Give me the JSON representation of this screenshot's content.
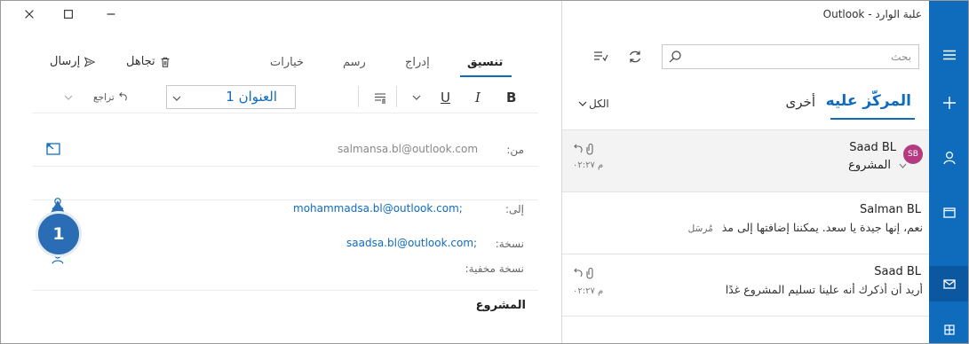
{
  "window": {
    "title": "علبة الوارد - Outlook"
  },
  "nav_rail": {
    "items": [
      "menu-icon",
      "new-icon",
      "people-icon",
      "calendar-icon",
      "mail-icon",
      "grid-icon"
    ],
    "active": "mail-icon"
  },
  "list": {
    "search_placeholder": "بحث",
    "tabs": {
      "focused": "المركّز عليه",
      "other": "أخرى"
    },
    "filter": "الكل",
    "messages": [
      {
        "sender": "Saad BL",
        "avatar": "SB",
        "subject": "المشروع",
        "time": "م ٠٢:٢٧",
        "selected": true
      },
      {
        "sender": "Salman BL",
        "preview": "نعم، إنها جيدة يا سعد. يمكننا إضافتها إلى مذ",
        "status": "مُرسَل"
      },
      {
        "sender": "Saad BL",
        "preview": "أريد أن أذكرك أنه علينا تسليم المشروع غدًا",
        "time": "م ٠٢:٢٧"
      }
    ]
  },
  "compose": {
    "ribbon_tabs": [
      "تنسيق",
      "إدراج",
      "رسم",
      "خيارات"
    ],
    "active_tab": "تنسيق",
    "send": "إرسال",
    "discard": "تجاهل",
    "format": {
      "bold": "B",
      "italic": "I",
      "underline": "U",
      "style": "العنوان 1",
      "undo": "تراجع"
    },
    "from_label": "من:",
    "from_value": "salmansa.bl@outlook.com",
    "to_label": "إلى:",
    "to_value": "mohammadsa.bl@outlook.com;",
    "cc_label": "نسخة:",
    "cc_value": "saadsa.bl@outlook.com;",
    "bcc_label": "نسخة مخفية:",
    "subject": "المشروع"
  },
  "callout": {
    "number": "1"
  },
  "colors": {
    "accent": "#0f6cbd",
    "avatar": "#b43b80",
    "badge": "#2a6db5"
  }
}
